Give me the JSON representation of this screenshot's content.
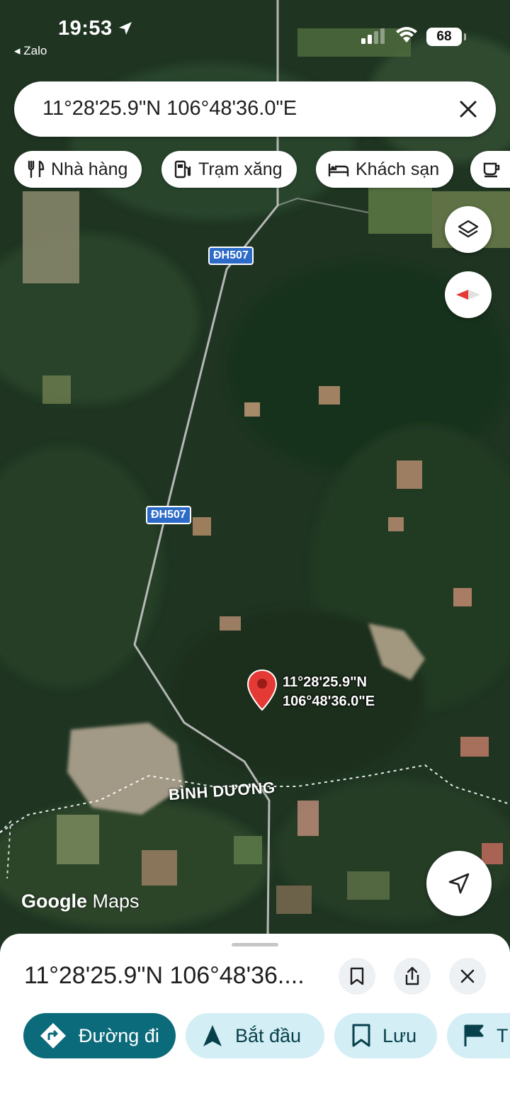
{
  "status_bar": {
    "time": "19:53",
    "back_app": "◂ Zalo",
    "battery": "68"
  },
  "search": {
    "query": "11°28'25.9\"N 106°48'36.0\"E"
  },
  "chips": [
    {
      "label": "Nhà hàng",
      "icon": "restaurant-icon"
    },
    {
      "label": "Trạm xăng",
      "icon": "gas-station-icon"
    },
    {
      "label": "Khách sạn",
      "icon": "hotel-icon"
    },
    {
      "label": "",
      "icon": "coffee-icon"
    }
  ],
  "map": {
    "road_shield_1": "ĐH507",
    "road_shield_2": "ĐH507",
    "province_label": "BÌNH DƯƠNG",
    "pin_lat": "11°28'25.9\"N",
    "pin_lng": "106°48'36.0\"E",
    "logo_google": "Google",
    "logo_maps": " Maps",
    "pin_color": "#e53935"
  },
  "sheet": {
    "title": "11°28'25.9\"N 106°48'36....",
    "actions": {
      "directions": "Đường đi",
      "start": "Bắt đầu",
      "save": "Lưu",
      "more": "T"
    }
  },
  "colors": {
    "primary_button": "#0b6b7a",
    "secondary_button": "#d3eef5"
  }
}
